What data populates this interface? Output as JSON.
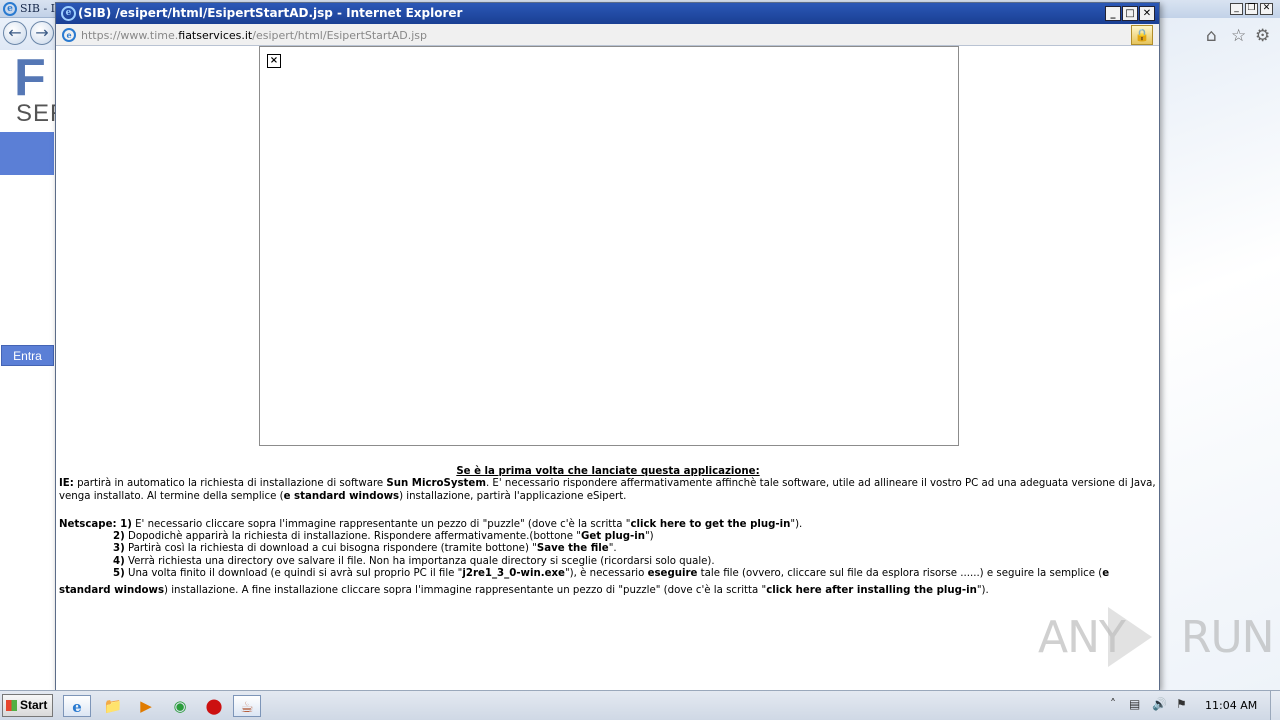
{
  "background_window": {
    "title": "SIB - I",
    "logo_text": "F",
    "logo_subtext": "SER",
    "login_button": "Entra"
  },
  "popup": {
    "title": "(SIB) /esipert/html/EsipertStartAD.jsp - Internet Explorer",
    "address": {
      "prefix": "https://www.time.",
      "host": "fiatservices.it",
      "path": "/esipert/html/EsipertStartAD.jsp"
    }
  },
  "instructions": {
    "heading": "Se è la prima volta che lanciate questa applicazione:",
    "ie_label": "IE:",
    "ie_text_1": " partirà in automatico la richiesta di installazione di software ",
    "ie_bold_1": "Sun MicroSystem",
    "ie_text_2": ". E' necessario rispondere affermativamente affinchè tale software, utile ad allineare il vostro PC ad una adeguata versione di Java, venga installato. Al termine della semplice (",
    "ie_bold_2": "e standard windows",
    "ie_text_3": ") installazione, partirà l'applicazione eSipert.",
    "netscape_label": "Netscape:",
    "step1_num": " 1)",
    "step1_text_1": " E' necessario cliccare sopra l'immagine rappresentante un pezzo di \"puzzle\" (dove c'è la scritta \"",
    "step1_bold": "click here to get the plug-in",
    "step1_text_2": "\").",
    "step2_num": "2)",
    "step2_text_1": " Dopodichè apparirà la richiesta di installazione. Rispondere affermativamente.(bottone \"",
    "step2_bold": "Get plug-in",
    "step2_text_2": "\")",
    "step3_num": "3)",
    "step3_text_1": " Partirà così la richiesta di download a cui bisogna rispondere (tramite bottone) \"",
    "step3_bold": "Save the file",
    "step3_text_2": "\".",
    "step4_num": "4)",
    "step4_text": " Verrà richiesta una directory ove salvare il file. Non ha importanza quale directory si sceglie (ricordarsi solo quale).",
    "step5_num": "5)",
    "step5_text_1": " Una volta finito il download (e quindi si avrà sul proprio PC il file \"",
    "step5_bold_1": "j2re1_3_0-win.exe",
    "step5_text_2": "\"), è necessario ",
    "step5_bold_2": "eseguire",
    "step5_text_3": " tale file (ovvero, cliccare sul file da esplora risorse ......) e seguire  la semplice (",
    "step5_bold_3": "e",
    "step5_bold_4": "standard windows",
    "step5_text_4": ") installazione. A fine installazione cliccare sopra l'immagine rappresentante un pezzo di \"puzzle\"  (dove c'è la scritta \"",
    "step5_bold_5": "click here after installing the plug-in",
    "step5_text_5": "\")."
  },
  "watermark": {
    "text_left": "ANY",
    "text_right": "RUN"
  },
  "taskbar": {
    "start_label": "Start",
    "clock": "11:04 AM"
  },
  "colors": {
    "popup_titlebar": "#1a3f93",
    "brand_blue": "#5b7fd6"
  },
  "icons": {
    "back": "back-arrow-icon",
    "forward": "forward-arrow-icon",
    "home": "home-icon",
    "favorites": "star-icon",
    "tools": "gear-icon",
    "lock": "lock-icon",
    "broken_image": "broken-image-icon"
  }
}
